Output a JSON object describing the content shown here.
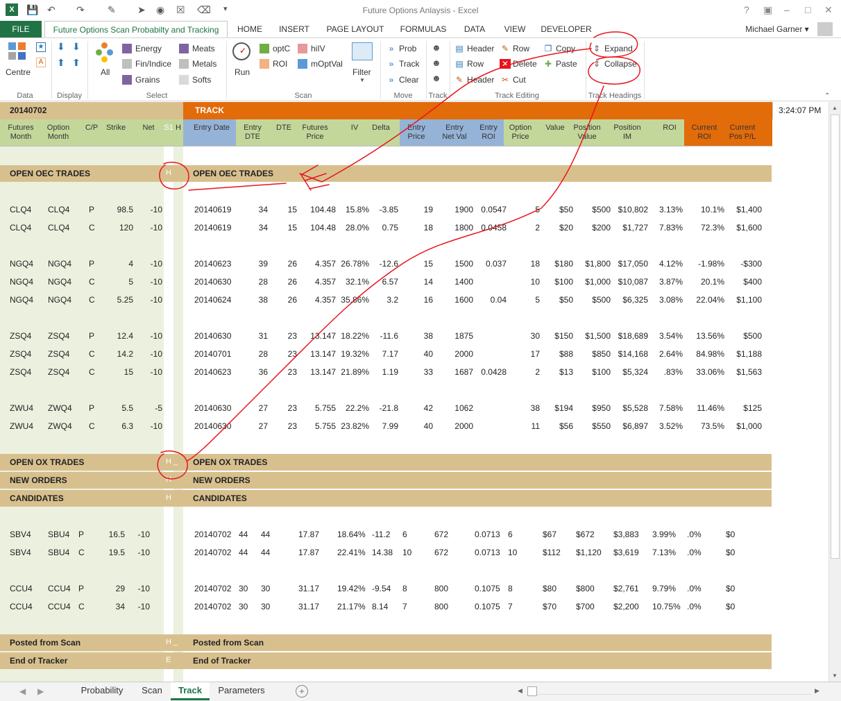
{
  "window": {
    "title": "Future Options Anlaysis - Excel",
    "user": "Michael Garner"
  },
  "tabs": [
    "FILE",
    "Future Options Scan Probabilty and Tracking",
    "HOME",
    "INSERT",
    "PAGE LAYOUT",
    "FORMULAS",
    "DATA",
    "VIEW",
    "DEVELOPER"
  ],
  "ribbon": {
    "data_group": {
      "label": "Data",
      "centre": "Centre"
    },
    "display_group": {
      "label": "Display"
    },
    "select_group": {
      "label": "Select",
      "all": "All",
      "items": [
        "Energy",
        "Fin/Indice",
        "Grains",
        "Meats",
        "Metals",
        "Softs"
      ]
    },
    "scan_group": {
      "label": "Scan",
      "run": "Run",
      "items": [
        "optC",
        "ROI",
        "hiIV",
        "mOptVal"
      ],
      "filter": "Filter"
    },
    "move_group": {
      "label": "Move",
      "items": [
        "Prob",
        "Track",
        "Clear"
      ]
    },
    "track_group": {
      "label": "Track"
    },
    "track_editing": {
      "label": "Track Editing",
      "items": [
        "Header",
        "Row",
        "Header",
        "Row",
        "Delete",
        "Cut",
        "Copy",
        "Paste"
      ]
    },
    "track_headings": {
      "label": "Track Headings",
      "expand": "Expand",
      "collapse": "Collapse"
    }
  },
  "sheet": {
    "date_cell": "20140702",
    "track_label": "TRACK",
    "time": "3:24:07 PM",
    "headers_left": [
      [
        "Futures",
        "Month"
      ],
      [
        "Option",
        "Month"
      ],
      [
        "C/P",
        ""
      ],
      [
        "Strike",
        ""
      ],
      [
        "Net",
        ""
      ],
      [
        "S1",
        ""
      ],
      [
        "H",
        ""
      ]
    ],
    "headers_right": [
      [
        "Entry Date",
        ""
      ],
      [
        "Entry",
        "DTE"
      ],
      [
        "DTE",
        ""
      ],
      [
        "Futures",
        "Price"
      ],
      [
        "IV",
        ""
      ],
      [
        "Delta",
        ""
      ],
      [
        "Entry",
        "Price"
      ],
      [
        "Entry",
        "Net Val"
      ],
      [
        "Entry",
        "ROI"
      ],
      [
        "Option",
        "Price"
      ],
      [
        "Value",
        ""
      ],
      [
        "Position",
        "Value"
      ],
      [
        "Position",
        "IM"
      ],
      [
        "ROI",
        ""
      ],
      [
        "Current",
        "ROI"
      ],
      [
        "Current",
        "Pos P/L"
      ]
    ],
    "sections": {
      "oec": {
        "left": "OPEN OEC TRADES",
        "h": "H",
        "right": "OPEN OEC TRADES"
      },
      "ox": {
        "left": "OPEN OX TRADES",
        "h": "H _",
        "right": "OPEN OX TRADES"
      },
      "new": {
        "left": "NEW ORDERS",
        "h": "H",
        "right": "NEW ORDERS"
      },
      "cand": {
        "left": "CANDIDATES",
        "h": "H",
        "right": "CANDIDATES"
      },
      "posted": {
        "left": "Posted from Scan",
        "h": "H _",
        "right": "Posted from Scan"
      },
      "end": {
        "left": "End of Tracker",
        "h": "E",
        "right": "End of Tracker"
      }
    },
    "rows_a": [
      [
        "CLQ4",
        "CLQ4",
        "P",
        "98.5",
        "-10",
        "20140619",
        "34",
        "15",
        "104.48",
        "15.8%",
        "-3.85",
        "19",
        "1900",
        "0.0547",
        "5",
        "$50",
        "$500",
        "$10,802",
        "3.13%",
        "10.1%",
        "$1,400"
      ],
      [
        "CLQ4",
        "CLQ4",
        "C",
        "120",
        "-10",
        "20140619",
        "34",
        "15",
        "104.48",
        "28.0%",
        "0.75",
        "18",
        "1800",
        "0.0458",
        "2",
        "$20",
        "$200",
        "$1,727",
        "7.83%",
        "72.3%",
        "$1,600"
      ],
      null,
      [
        "NGQ4",
        "NGQ4",
        "P",
        "4",
        "-10",
        "20140623",
        "39",
        "26",
        "4.357",
        "26.78%",
        "-12.6",
        "15",
        "1500",
        "0.037",
        "18",
        "$180",
        "$1,800",
        "$17,050",
        "4.12%",
        "-1.98%",
        "-$300"
      ],
      [
        "NGQ4",
        "NGQ4",
        "C",
        "5",
        "-10",
        "20140630",
        "28",
        "26",
        "4.357",
        "32.1%",
        "6.57",
        "14",
        "1400",
        "",
        "10",
        "$100",
        "$1,000",
        "$10,087",
        "3.87%",
        "20.1%",
        "$400"
      ],
      [
        "NGQ4",
        "NGQ4",
        "C",
        "5.25",
        "-10",
        "20140624",
        "38",
        "26",
        "4.357",
        "35.86%",
        "3.2",
        "16",
        "1600",
        "0.04",
        "5",
        "$50",
        "$500",
        "$6,325",
        "3.08%",
        "22.04%",
        "$1,100"
      ],
      null,
      [
        "ZSQ4",
        "ZSQ4",
        "P",
        "12.4",
        "-10",
        "20140630",
        "31",
        "23",
        "13.147",
        "18.22%",
        "-11.6",
        "38",
        "1875",
        "",
        "30",
        "$150",
        "$1,500",
        "$18,689",
        "3.54%",
        "13.56%",
        "$500"
      ],
      [
        "ZSQ4",
        "ZSQ4",
        "C",
        "14.2",
        "-10",
        "20140701",
        "28",
        "23",
        "13.147",
        "19.32%",
        "7.17",
        "40",
        "2000",
        "",
        "17",
        "$88",
        "$850",
        "$14,168",
        "2.64%",
        "84.98%",
        "$1,188"
      ],
      [
        "ZSQ4",
        "ZSQ4",
        "C",
        "15",
        "-10",
        "20140623",
        "36",
        "23",
        "13.147",
        "21.89%",
        "1.19",
        "33",
        "1687",
        "0.0428",
        "2",
        "$13",
        "$100",
        "$5,324",
        ".83%",
        "33.06%",
        "$1,563"
      ],
      null,
      [
        "ZWU4",
        "ZWQ4",
        "P",
        "5.5",
        "-5",
        "20140630",
        "27",
        "23",
        "5.755",
        "22.2%",
        "-21.8",
        "42",
        "1062",
        "",
        "38",
        "$194",
        "$950",
        "$5,528",
        "7.58%",
        "11.46%",
        "$125"
      ],
      [
        "ZWU4",
        "ZWQ4",
        "C",
        "6.3",
        "-10",
        "20140630",
        "27",
        "23",
        "5.755",
        "23.82%",
        "7.99",
        "40",
        "2000",
        "",
        "11",
        "$56",
        "$550",
        "$6,897",
        "3.52%",
        "73.5%",
        "$1,000"
      ]
    ],
    "rows_b": [
      [
        "SBV4",
        "SBU4",
        "P",
        "16.5",
        "-10",
        "20140702",
        "44",
        "44",
        "17.87",
        "18.64%",
        "-11.2",
        "6",
        "672",
        "0.0713",
        "6",
        "$67",
        "$672",
        "$3,883",
        "3.99%",
        ".0%",
        "$0"
      ],
      [
        "SBV4",
        "SBU4",
        "C",
        "19.5",
        "-10",
        "20140702",
        "44",
        "44",
        "17.87",
        "22.41%",
        "14.38",
        "10",
        "672",
        "0.0713",
        "10",
        "$112",
        "$1,120",
        "$3,619",
        "7.13%",
        ".0%",
        "$0"
      ],
      null,
      [
        "CCU4",
        "CCU4",
        "P",
        "29",
        "-10",
        "20140702",
        "30",
        "30",
        "31.17",
        "19.42%",
        "-9.54",
        "8",
        "800",
        "0.1075",
        "8",
        "$80",
        "$800",
        "$2,761",
        "9.79%",
        ".0%",
        "$0"
      ],
      [
        "CCU4",
        "CCU4",
        "C",
        "34",
        "-10",
        "20140702",
        "30",
        "30",
        "31.17",
        "21.17%",
        "8.14",
        "7",
        "800",
        "0.1075",
        "7",
        "$70",
        "$700",
        "$2,200",
        "10.75%",
        ".0%",
        "$0"
      ]
    ]
  },
  "sheet_tabs": [
    "Probability",
    "Scan",
    "Track",
    "Parameters"
  ],
  "active_sheet": "Track",
  "colors": {
    "excel_green": "#217346",
    "section_tan": "#d8c08e",
    "track_orange": "#e26b0a",
    "header_green": "#c4d79b",
    "header_blue": "#95b3d7",
    "annotation_red": "#e8141c"
  }
}
